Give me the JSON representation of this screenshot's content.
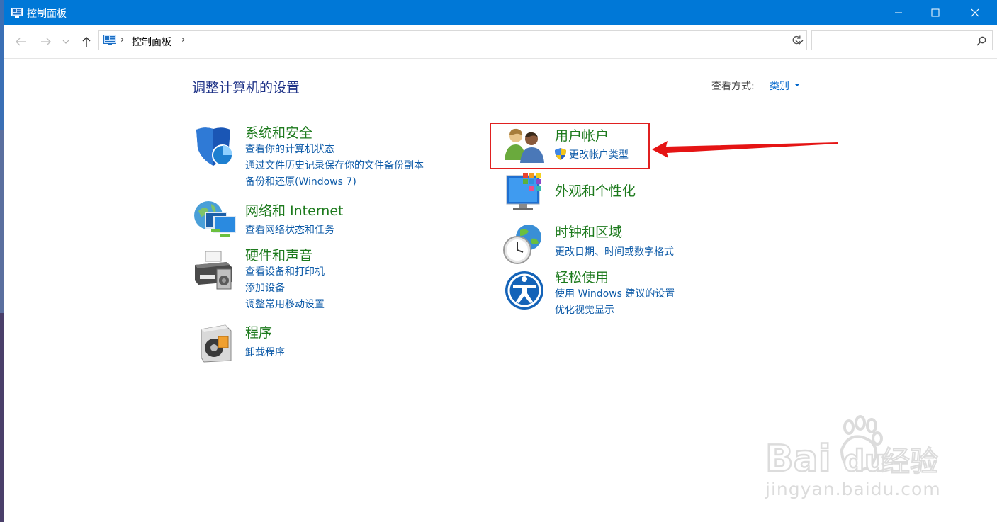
{
  "window": {
    "title": "控制面板"
  },
  "address": {
    "crumb": "控制面板",
    "search_placeholder": ""
  },
  "main": {
    "heading": "调整计算机的设置",
    "view_by_label": "查看方式:",
    "view_by_value": "类别"
  },
  "categories": [
    {
      "title": "系统和安全",
      "links": [
        "查看你的计算机状态",
        "通过文件历史记录保存你的文件备份副本",
        "备份和还原(Windows 7)"
      ]
    },
    {
      "title": "网络和 Internet",
      "links": [
        "查看网络状态和任务"
      ]
    },
    {
      "title": "硬件和声音",
      "links": [
        "查看设备和打印机",
        "添加设备",
        "调整常用移动设置"
      ]
    },
    {
      "title": "程序",
      "links": [
        "卸载程序"
      ]
    },
    {
      "title": "用户帐户",
      "links": [
        "更改帐户类型"
      ]
    },
    {
      "title": "外观和个性化",
      "links": []
    },
    {
      "title": "时钟和区域",
      "links": [
        "更改日期、时间或数字格式"
      ]
    },
    {
      "title": "轻松使用",
      "links": [
        "使用 Windows 建议的设置",
        "优化视觉显示"
      ]
    }
  ],
  "watermark": {
    "text": "jingyan.baidu.com",
    "logo": "Baidu经验"
  },
  "colors": {
    "titlebar": "#0078d7",
    "category_title": "#1d7a1d",
    "link": "#0e5ba8",
    "highlight": "#e02020"
  }
}
